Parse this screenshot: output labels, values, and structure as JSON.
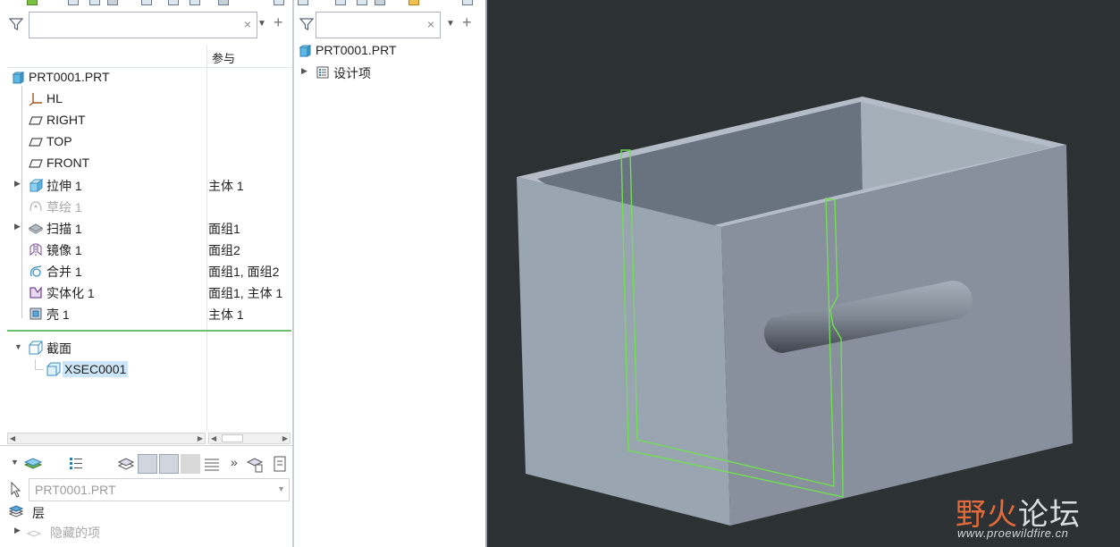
{
  "model_tree": {
    "search_placeholder": "",
    "column_header": "参与",
    "items": [
      {
        "label": "PRT0001.PRT",
        "ref": ""
      },
      {
        "label": "HL",
        "ref": ""
      },
      {
        "label": "RIGHT",
        "ref": ""
      },
      {
        "label": "TOP",
        "ref": ""
      },
      {
        "label": "FRONT",
        "ref": ""
      },
      {
        "label": "拉伸 1",
        "ref": "主体 1"
      },
      {
        "label": "草绘 1",
        "ref": ""
      },
      {
        "label": "扫描 1",
        "ref": "面组1"
      },
      {
        "label": "镜像 1",
        "ref": "面组2"
      },
      {
        "label": "合并 1",
        "ref": "面组1, 面组2"
      },
      {
        "label": "实体化 1",
        "ref": "面组1, 主体 1"
      },
      {
        "label": "壳 1",
        "ref": "主体 1"
      },
      {
        "label": "截面",
        "ref": ""
      },
      {
        "label": "XSEC0001",
        "ref": ""
      }
    ]
  },
  "layer_tree": {
    "active_model": "PRT0001.PRT",
    "items": [
      {
        "label": "层"
      },
      {
        "label": "隐藏的项"
      }
    ]
  },
  "detail_tree": {
    "search_placeholder": "",
    "items": [
      {
        "label": "PRT0001.PRT"
      },
      {
        "label": "设计项"
      }
    ]
  },
  "viewport": {
    "background": "#2c3233",
    "section_color": "#6fe04f",
    "watermark_left": "野火",
    "watermark_right": "论坛",
    "watermark_url": "www.proewildfire.cn"
  }
}
